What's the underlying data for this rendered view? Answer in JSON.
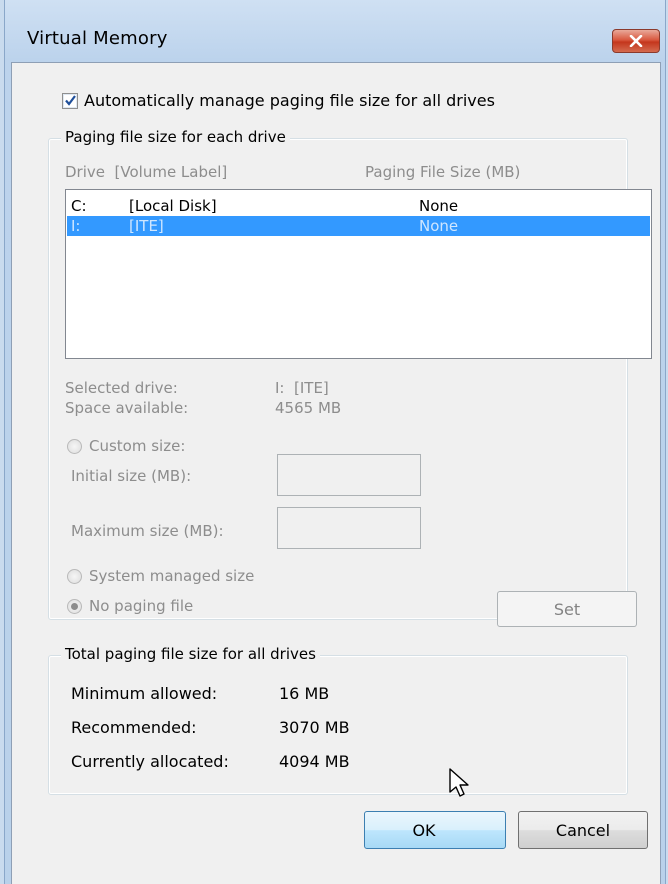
{
  "window": {
    "title": "Virtual Memory"
  },
  "auto_manage": {
    "checked": true,
    "label": "Automatically manage paging file size for all drives"
  },
  "paging_group": {
    "legend": "Paging file size for each drive",
    "col_drive": "Drive  [Volume Label]",
    "col_size": "Paging File Size (MB)",
    "drives": [
      {
        "letter": "C:",
        "label": "[Local Disk]",
        "size": "None",
        "selected": false
      },
      {
        "letter": "I:",
        "label": "[ITE]",
        "size": "None",
        "selected": true
      }
    ],
    "selected_drive_label": "Selected drive:",
    "selected_drive_value": "I:  [ITE]",
    "space_available_label": "Space available:",
    "space_available_value": "4565 MB",
    "custom_size_label": "Custom size:",
    "initial_size_label": "Initial size (MB):",
    "initial_size_value": "",
    "maximum_size_label": "Maximum size (MB):",
    "maximum_size_value": "",
    "system_managed_label": "System managed size",
    "no_paging_label": "No paging file",
    "selected_option": "no_paging",
    "set_label": "Set"
  },
  "total_group": {
    "legend": "Total paging file size for all drives",
    "minimum_label": "Minimum allowed:",
    "minimum_value": "16 MB",
    "recommended_label": "Recommended:",
    "recommended_value": "3070 MB",
    "allocated_label": "Currently allocated:",
    "allocated_value": "4094 MB"
  },
  "buttons": {
    "ok": "OK",
    "cancel": "Cancel"
  },
  "colors": {
    "selection": "#3399ff",
    "close_button": "#c4361d",
    "window_frame": "#bcd3ec"
  },
  "icons": {
    "close": "close-x-icon",
    "check": "checkmark-icon",
    "cursor": "mouse-pointer-icon"
  }
}
